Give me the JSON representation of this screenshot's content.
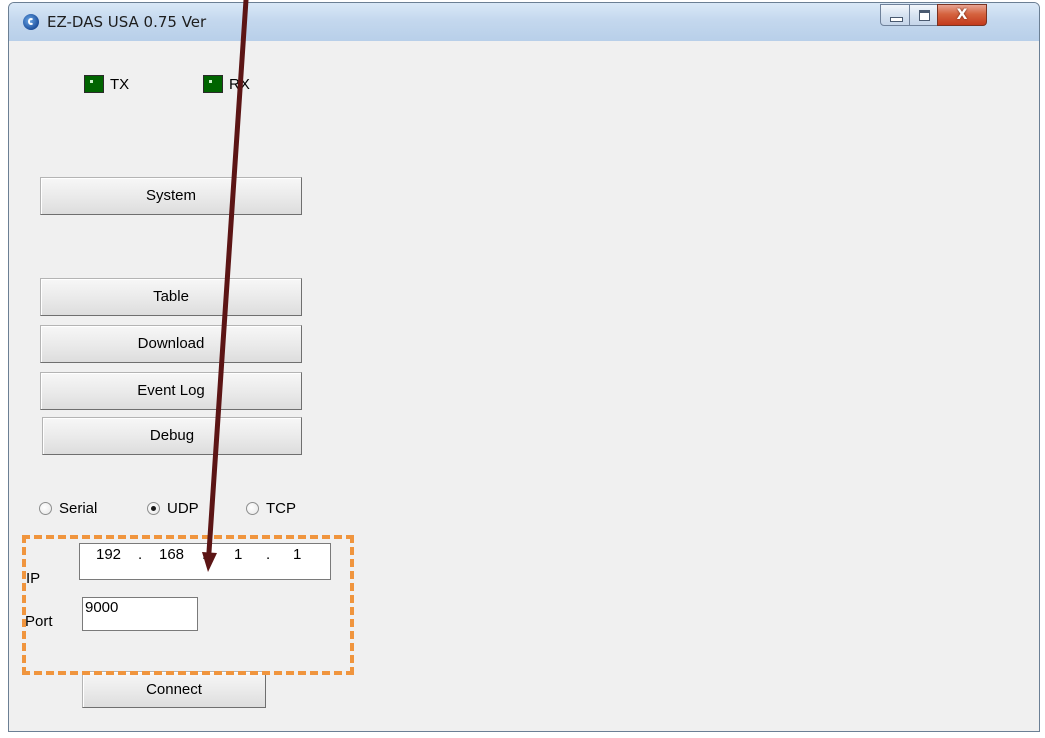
{
  "window": {
    "title": "EZ-DAS USA 0.75 Ver",
    "close_glyph": "X"
  },
  "indicators": {
    "tx_label": "TX",
    "rx_label": "RX",
    "led_color": "#006400"
  },
  "buttons": {
    "system": "System",
    "table": "Table",
    "download": "Download",
    "event_log": "Event Log",
    "debug": "Debug",
    "connect": "Connect"
  },
  "connection_type": {
    "options": [
      "Serial",
      "UDP",
      "TCP"
    ],
    "selected": "UDP"
  },
  "ip": {
    "label": "IP",
    "octets": [
      "192",
      "168",
      "1",
      "1"
    ],
    "separator": "."
  },
  "port": {
    "label": "Port",
    "value": "9000"
  },
  "annotation": {
    "highlight_color": "#f0953e",
    "arrow_color": "#5c1515"
  }
}
